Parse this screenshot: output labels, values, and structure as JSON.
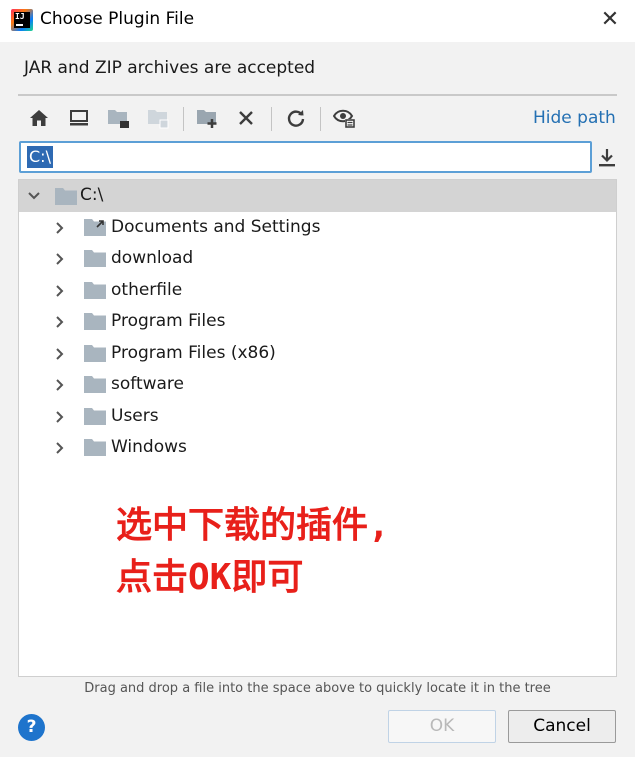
{
  "window": {
    "title": "Choose Plugin File",
    "close_label": "✕"
  },
  "description": "JAR and ZIP archives are accepted",
  "toolbar": {
    "buttons": [
      "home-icon",
      "desktop-icon",
      "project-folder-icon",
      "module-folder-icon",
      "new-folder-icon",
      "delete-icon",
      "refresh-icon",
      "show-hidden-icon"
    ],
    "hide_path_label": "Hide path"
  },
  "path_field": {
    "value": "C:\\"
  },
  "tree": {
    "root": {
      "label": "C:\\",
      "expanded": true
    },
    "items": [
      {
        "label": "Documents and Settings",
        "type": "shortcut-folder"
      },
      {
        "label": "download",
        "type": "folder"
      },
      {
        "label": "otherfile",
        "type": "folder"
      },
      {
        "label": "Program Files",
        "type": "folder"
      },
      {
        "label": "Program Files (x86)",
        "type": "folder"
      },
      {
        "label": "software",
        "type": "folder"
      },
      {
        "label": "Users",
        "type": "folder"
      },
      {
        "label": "Windows",
        "type": "folder"
      }
    ]
  },
  "annotation": {
    "line1": "选中下载的插件,",
    "line2": "点击OK即可",
    "color": "#e8201a"
  },
  "hint": "Drag and drop a file into the space above to quickly locate it in the tree",
  "buttons": {
    "help": "?",
    "ok": "OK",
    "cancel": "Cancel"
  },
  "colors": {
    "accent": "#2470b3",
    "selection": "#2e6ab3",
    "folder": "#a9b5bf"
  }
}
